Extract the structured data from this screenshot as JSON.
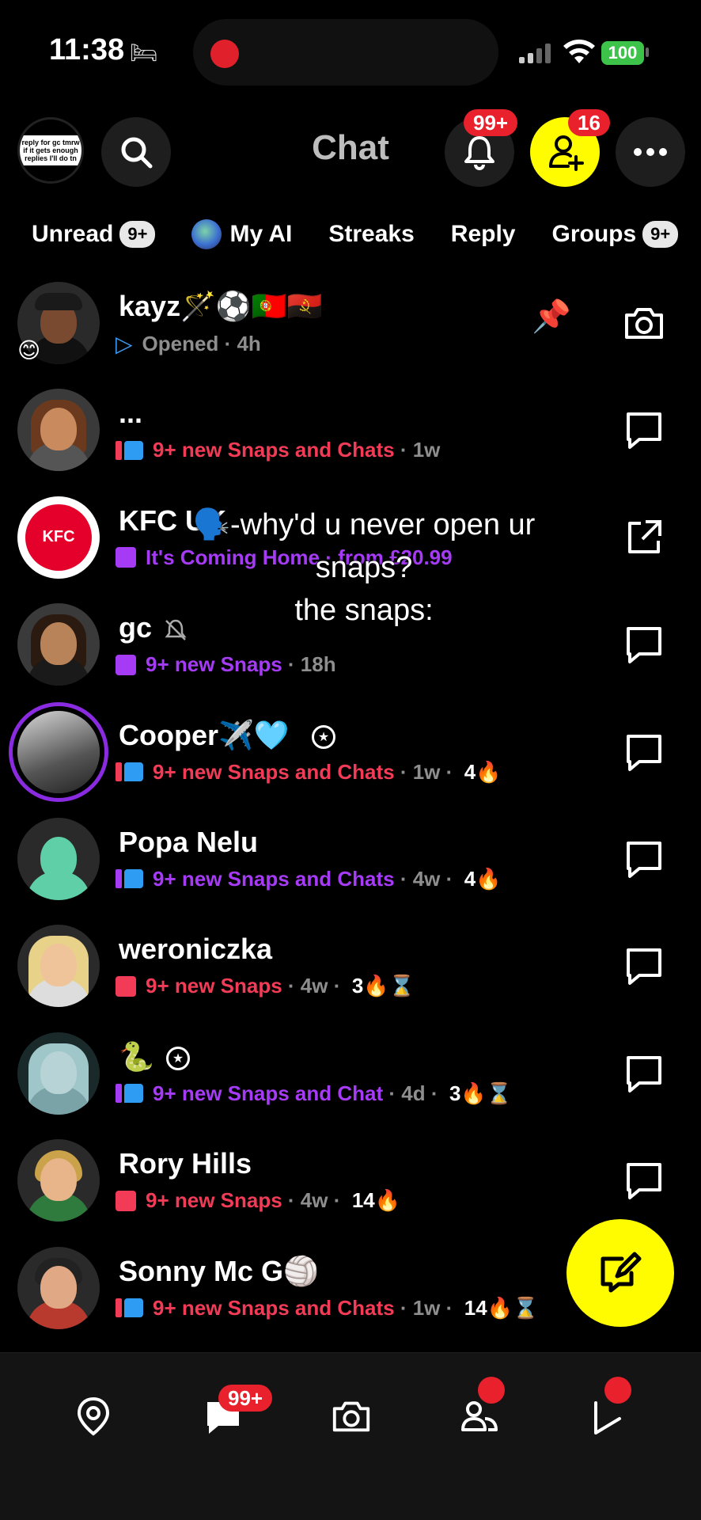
{
  "status_bar": {
    "time": "11:38",
    "battery": "100"
  },
  "header": {
    "title": "Chat",
    "profile_note": "reply for gc tmrw if it gets enough replies I'll do tn",
    "notifications_badge": "99+",
    "add_friend_badge": "16"
  },
  "tabs": [
    {
      "label": "Unread",
      "count": "9+"
    },
    {
      "label": "My AI"
    },
    {
      "label": "Streaks"
    },
    {
      "label": "Reply"
    },
    {
      "label": "Groups",
      "count": "9+"
    }
  ],
  "chats": [
    {
      "name": "kayz🪄⚽🇵🇹🇦🇴",
      "status": "Opened",
      "time": "4h",
      "streak": ""
    },
    {
      "name": "...",
      "status": "9+ new Snaps and Chats",
      "time": "1w",
      "streak": ""
    },
    {
      "name": "KFC UK",
      "status": "It's Coming Home · from £20.99",
      "time": "",
      "streak": ""
    },
    {
      "name": "gc",
      "status": "9+ new Snaps",
      "time": "18h",
      "streak": ""
    },
    {
      "name": "Cooper✈️🩵",
      "status": "9+ new Snaps and Chats",
      "time": "1w",
      "streak": "4🔥"
    },
    {
      "name": "Popa Nelu",
      "status": "9+ new Snaps and Chats",
      "time": "4w",
      "streak": "4🔥"
    },
    {
      "name": "weroniczka",
      "status": "9+ new Snaps",
      "time": "4w",
      "streak": "3🔥⌛"
    },
    {
      "name": "🐍",
      "status": "9+ new Snaps and Chat",
      "time": "4d",
      "streak": "3🔥⌛"
    },
    {
      "name": "Rory Hills",
      "status": "9+ new Snaps",
      "time": "4w",
      "streak": "14🔥"
    },
    {
      "name": "Sonny Mc G🏐",
      "status": "9+ new Snaps and Chats",
      "time": "1w",
      "streak": "14🔥⌛"
    }
  ],
  "caption": {
    "line1": "🗣️-why'd u never open ur snaps?",
    "line2": "the snaps:"
  },
  "bottom_nav": {
    "chat_badge": "99+"
  },
  "colors": {
    "accent_yellow": "#fffc00",
    "badge_red": "#e8212d",
    "snap_red": "#f23c57",
    "snap_purple": "#a63bf6"
  }
}
